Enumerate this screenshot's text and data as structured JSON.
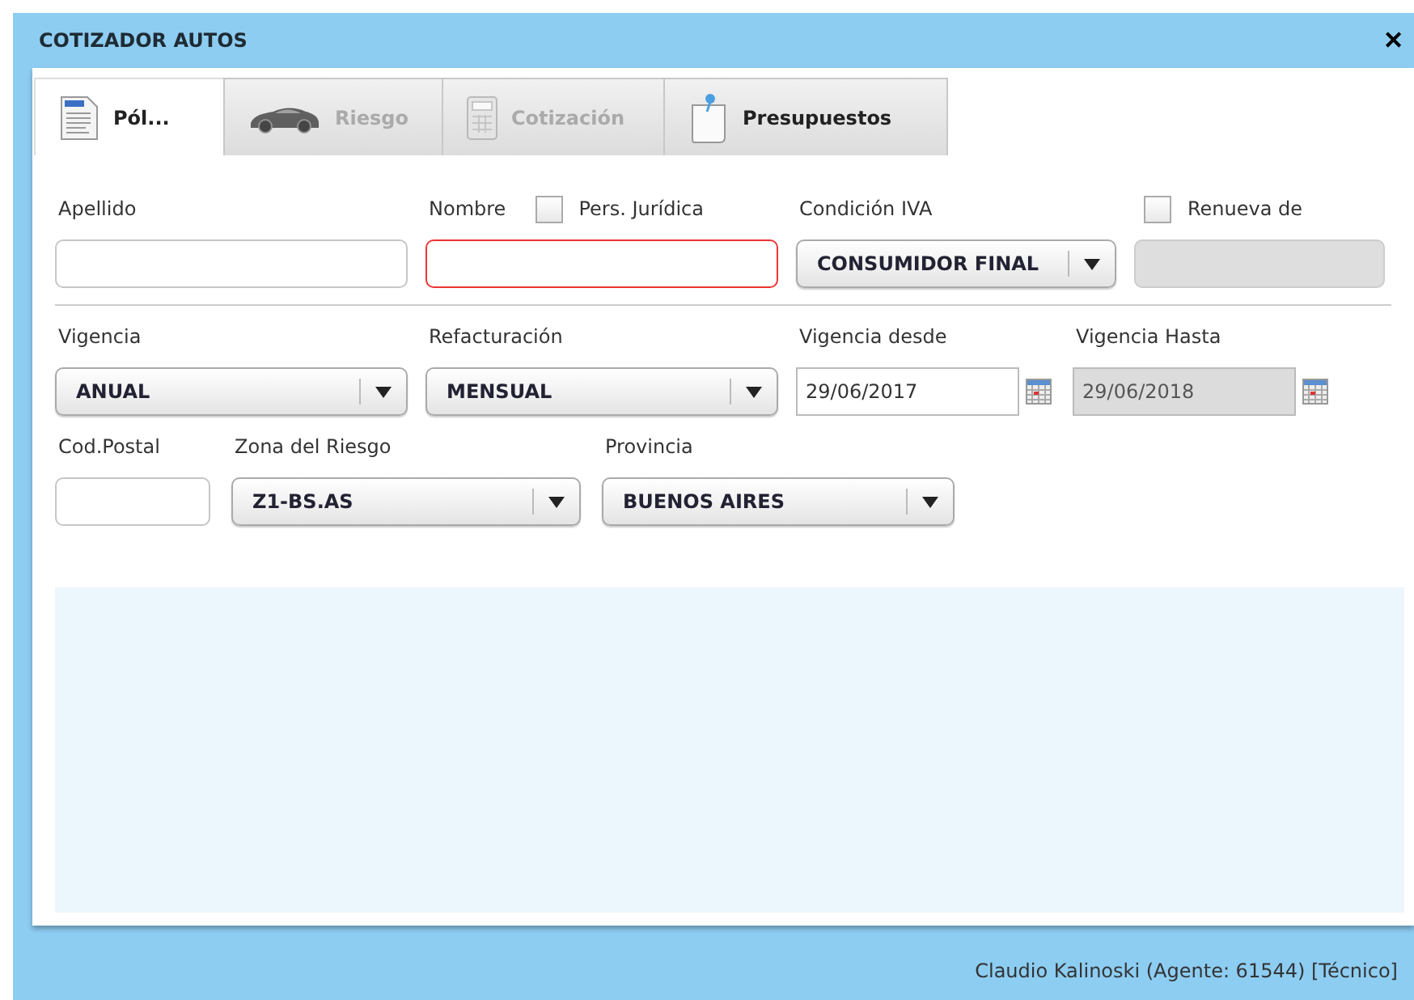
{
  "window": {
    "title": "COTIZADOR AUTOS",
    "close": "✕"
  },
  "tabs": [
    {
      "label": "Pól...",
      "selected": true,
      "disabled": false
    },
    {
      "label": "Riesgo",
      "selected": false,
      "disabled": true
    },
    {
      "label": "Cotización",
      "selected": false,
      "disabled": true
    },
    {
      "label": "Presupuestos",
      "selected": false,
      "disabled": false
    }
  ],
  "form_rows": [
    [
      {
        "label": "Apellido",
        "kind": "text",
        "invalid": false,
        "disabled": false
      },
      {
        "label": "Nombre",
        "kind": "text",
        "invalid": true,
        "disabled": false,
        "checkbox": {
          "label": "Pers. Jurídica",
          "checked": false
        }
      },
      {
        "label": "Condición IVA",
        "kind": "select",
        "value": "CONSUMIDOR FINAL"
      },
      {
        "kind": "text",
        "invalid": false,
        "disabled": true,
        "checkbox": {
          "label": "Renueva de",
          "checked": false
        }
      }
    ],
    [
      {
        "label": "Vigencia",
        "kind": "select",
        "value": "ANUAL"
      },
      {
        "label": "Refacturación",
        "kind": "select",
        "value": "MENSUAL"
      },
      {
        "label": "Vigencia desde",
        "kind": "date",
        "value": "29/06/2017",
        "disabled": false
      },
      {
        "label": "Vigencia Hasta",
        "kind": "date",
        "value": "29/06/2018",
        "disabled": true
      }
    ],
    [
      {
        "label": "Cod.Postal",
        "kind": "text",
        "invalid": false,
        "disabled": false
      },
      {
        "label": "Zona del Riesgo",
        "kind": "select",
        "value": "Z1-BS.AS"
      },
      {
        "label": "Provincia",
        "kind": "select",
        "value": "BUENOS AIRES"
      }
    ]
  ],
  "status_bar": {
    "user": "Claudio Kalinoski (Agente: 61544) [Técnico]"
  }
}
